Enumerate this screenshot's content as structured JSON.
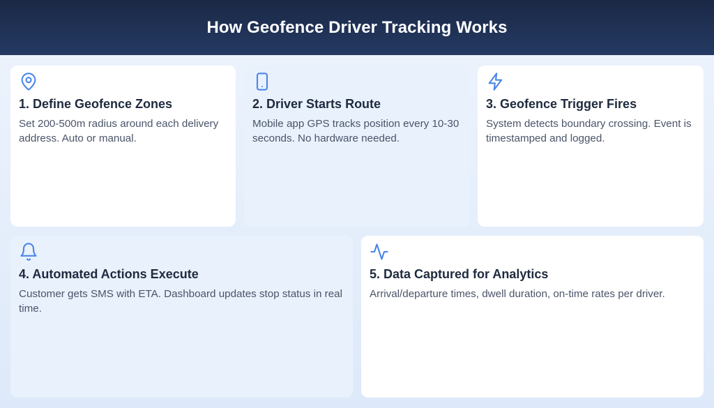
{
  "header": {
    "title": "How Geofence Driver Tracking Works"
  },
  "colors": {
    "header_bg": "#1b2845",
    "icon_accent": "#4a86e8",
    "title_text": "#1e2a3e",
    "body_text": "#4a5468"
  },
  "steps": [
    {
      "icon": "map-pin-icon",
      "title": "1. Define Geofence Zones",
      "description": "Set 200-500m radius around each delivery address. Auto or manual."
    },
    {
      "icon": "smartphone-icon",
      "title": "2. Driver Starts Route",
      "description": "Mobile app GPS tracks position every 10-30 seconds. No hardware needed."
    },
    {
      "icon": "lightning-icon",
      "title": "3. Geofence Trigger Fires",
      "description": "System detects boundary crossing. Event is timestamped and logged."
    },
    {
      "icon": "bell-icon",
      "title": "4. Automated Actions Execute",
      "description": "Customer gets SMS with ETA. Dashboard updates stop status in real time."
    },
    {
      "icon": "activity-pulse-icon",
      "title": "5. Data Captured for Analytics",
      "description": "Arrival/departure times, dwell duration, on-time rates per driver."
    }
  ]
}
